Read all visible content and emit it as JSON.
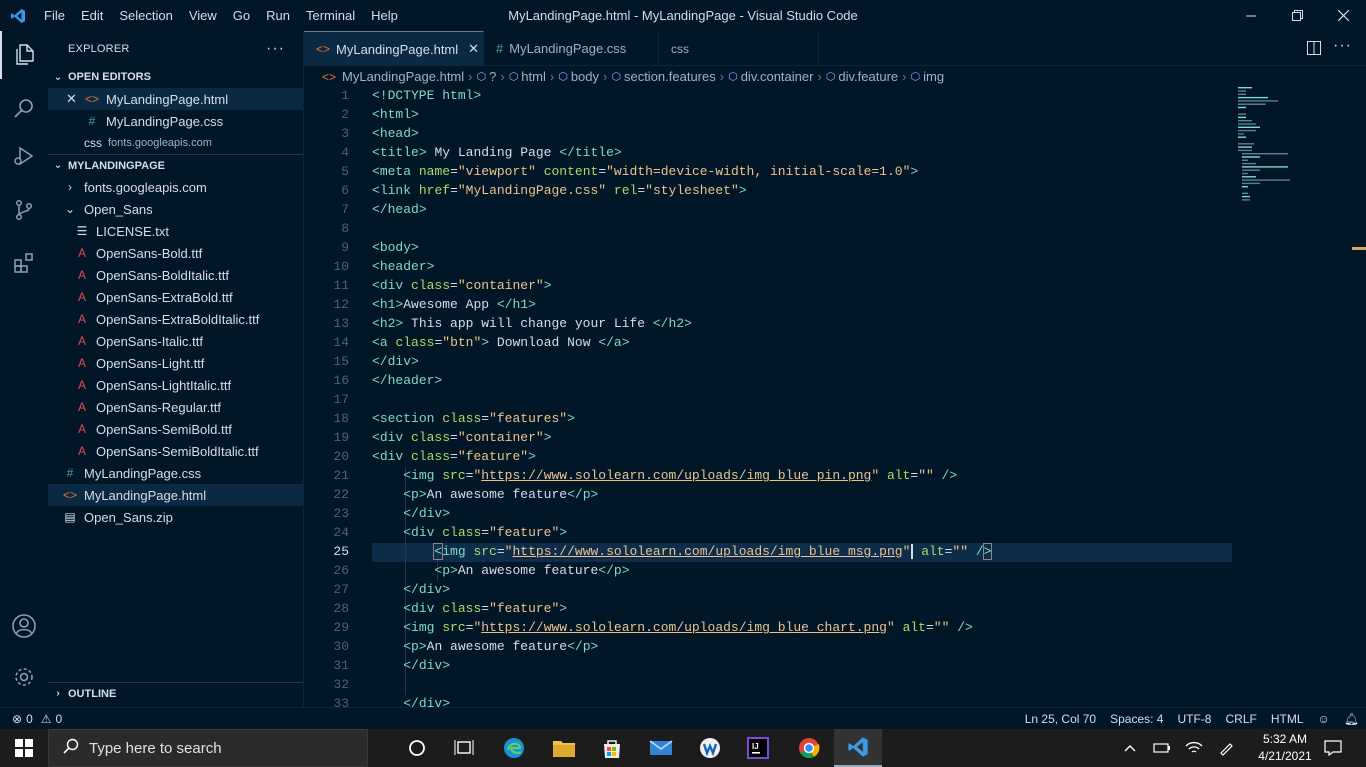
{
  "titlebar": {
    "menu": [
      "File",
      "Edit",
      "Selection",
      "View",
      "Go",
      "Run",
      "Terminal",
      "Help"
    ],
    "title": "MyLandingPage.html - MyLandingPage - Visual Studio Code"
  },
  "activity": {
    "icons": [
      "files-icon",
      "search-icon",
      "run-debug-icon",
      "source-control-icon",
      "extensions-icon",
      "account-icon",
      "settings-gear-icon"
    ]
  },
  "sidebar": {
    "title": "EXPLORER",
    "more": "···",
    "open_editors_label": "OPEN EDITORS",
    "open_editors": [
      {
        "icon": "<>",
        "name": "MyLandingPage.html",
        "sub": ""
      },
      {
        "icon": "#",
        "name": "MyLandingPage.css",
        "sub": ""
      },
      {
        "icon": "css",
        "name": "css",
        "sub": "fonts.googleapis.com"
      }
    ],
    "project_label": "MYLANDINGPAGE",
    "tree": [
      {
        "kind": "folder",
        "name": "fonts.googleapis.com",
        "indent": 1,
        "chev": "›"
      },
      {
        "kind": "folder",
        "name": "Open_Sans",
        "indent": 1,
        "chev": "⌄"
      },
      {
        "kind": "txt",
        "name": "LICENSE.txt",
        "indent": 2
      },
      {
        "kind": "font",
        "name": "OpenSans-Bold.ttf",
        "indent": 2
      },
      {
        "kind": "font",
        "name": "OpenSans-BoldItalic.ttf",
        "indent": 2
      },
      {
        "kind": "font",
        "name": "OpenSans-ExtraBold.ttf",
        "indent": 2
      },
      {
        "kind": "font",
        "name": "OpenSans-ExtraBoldItalic.ttf",
        "indent": 2
      },
      {
        "kind": "font",
        "name": "OpenSans-Italic.ttf",
        "indent": 2
      },
      {
        "kind": "font",
        "name": "OpenSans-Light.ttf",
        "indent": 2
      },
      {
        "kind": "font",
        "name": "OpenSans-LightItalic.ttf",
        "indent": 2
      },
      {
        "kind": "font",
        "name": "OpenSans-Regular.ttf",
        "indent": 2
      },
      {
        "kind": "font",
        "name": "OpenSans-SemiBold.ttf",
        "indent": 2
      },
      {
        "kind": "font",
        "name": "OpenSans-SemiBoldItalic.ttf",
        "indent": 2
      },
      {
        "kind": "css",
        "name": "MyLandingPage.css",
        "indent": 1
      },
      {
        "kind": "html",
        "name": "MyLandingPage.html",
        "indent": 1,
        "selected": true
      },
      {
        "kind": "zip",
        "name": "Open_Sans.zip",
        "indent": 1
      }
    ],
    "outline_label": "OUTLINE"
  },
  "tabs": [
    {
      "icon": "<>",
      "label": "MyLandingPage.html",
      "active": true
    },
    {
      "icon": "#",
      "label": "MyLandingPage.css",
      "active": false
    },
    {
      "icon": "css",
      "label": "css",
      "active": false
    }
  ],
  "breadcrumb": [
    "MyLandingPage.html",
    "?",
    "html",
    "body",
    "section.features",
    "div.container",
    "div.feature",
    "img"
  ],
  "editor": {
    "current_line": 25,
    "lines": [
      "1",
      "2",
      "3",
      "4",
      "5",
      "6",
      "7",
      "8",
      "9",
      "10",
      "11",
      "12",
      "13",
      "14",
      "15",
      "16",
      "17",
      "18",
      "19",
      "20",
      "21",
      "22",
      "23",
      "24",
      "25",
      "26",
      "27",
      "28",
      "29",
      "30",
      "31",
      "32",
      "33"
    ]
  },
  "statusbar": {
    "problems": "0",
    "warnings": "0",
    "position": "Ln 25, Col 70",
    "spaces": "Spaces: 4",
    "encoding": "UTF-8",
    "eol": "CRLF",
    "language": "HTML"
  },
  "taskbar": {
    "search_placeholder": "Type here to search",
    "time": "5:32 AM",
    "date": "4/21/2021"
  }
}
